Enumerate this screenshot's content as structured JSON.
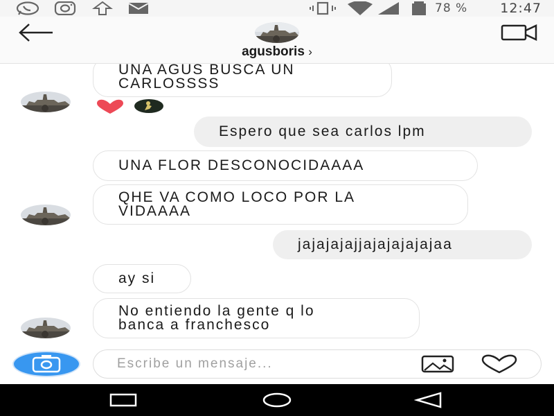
{
  "status_bar": {
    "battery_percent": "78 %",
    "time": "12:47",
    "notification_icons": [
      "whatsapp-icon",
      "instagram-icon",
      "upload-icon",
      "mail-icon"
    ],
    "system_icons": [
      "vibrate-icon",
      "wifi-icon",
      "signal-icon",
      "battery-icon"
    ]
  },
  "header": {
    "username": "agusboris",
    "chevron": "›"
  },
  "messages": [
    {
      "direction": "incoming",
      "text": "UNA AGUS BUSCA UN\nCARLOSSSS"
    },
    {
      "direction": "outgoing",
      "text": "Espero que sea carlos lpm"
    },
    {
      "direction": "incoming",
      "text": "UNA FLOR DESCONOCIDAAAA"
    },
    {
      "direction": "incoming",
      "text": "QHE VA COMO LOCO POR LA\nVIDAAAA"
    },
    {
      "direction": "outgoing",
      "text": "jajajajajjajajajajajaa"
    },
    {
      "direction": "incoming",
      "text": "ay si"
    },
    {
      "direction": "incoming",
      "text": "No entiendo la gente q lo\nbanca a franchesco"
    }
  ],
  "reactions": [
    "heart",
    "sticker"
  ],
  "composer": {
    "placeholder": "Escribe un mensaje..."
  },
  "colors": {
    "accent": "#3897f0",
    "reaction_heart": "#ed4956",
    "outgoing_bubble": "#efefef",
    "navbar": "#000000"
  }
}
